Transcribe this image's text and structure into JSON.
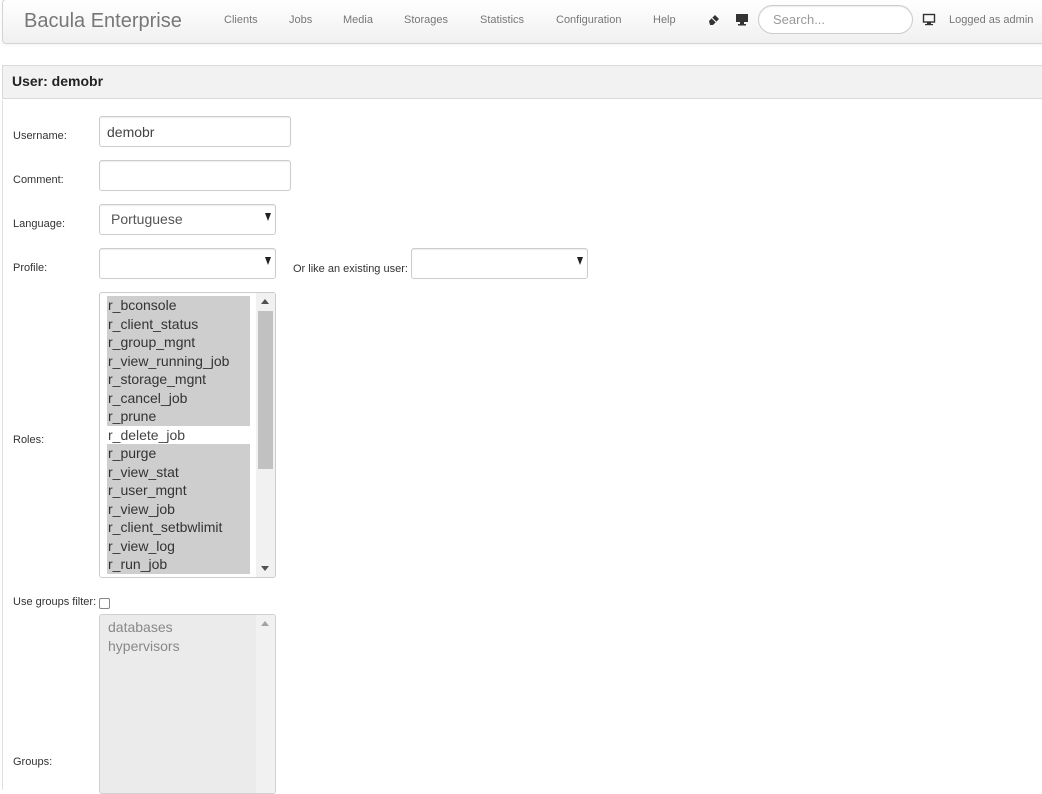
{
  "navbar": {
    "brand": "Bacula Enterprise",
    "menu": [
      "Clients",
      "Jobs",
      "Media",
      "Storages",
      "Statistics",
      "Configuration",
      "Help"
    ],
    "icons": [
      "eraser-icon",
      "monitor-icon"
    ],
    "search_placeholder": "Search...",
    "user_icon": "computer-icon",
    "logged_as": "Logged as admin"
  },
  "panel": {
    "title": "User: demobr"
  },
  "form": {
    "username": {
      "label": "Username:",
      "value": "demobr"
    },
    "comment": {
      "label": "Comment:",
      "value": ""
    },
    "language": {
      "label": "Language:",
      "value": "Portuguese"
    },
    "profile": {
      "label": "Profile:",
      "value": ""
    },
    "like_user": {
      "label": "Or like an existing user:",
      "value": ""
    },
    "roles": {
      "label": "Roles:",
      "options": [
        {
          "label": "r_bconsole",
          "selected": true
        },
        {
          "label": "r_client_status",
          "selected": true
        },
        {
          "label": "r_group_mgnt",
          "selected": true
        },
        {
          "label": "r_view_running_job",
          "selected": true
        },
        {
          "label": "r_storage_mgnt",
          "selected": true
        },
        {
          "label": "r_cancel_job",
          "selected": true
        },
        {
          "label": "r_prune",
          "selected": true
        },
        {
          "label": "r_delete_job",
          "selected": false
        },
        {
          "label": "r_purge",
          "selected": true
        },
        {
          "label": "r_view_stat",
          "selected": true
        },
        {
          "label": "r_user_mgnt",
          "selected": true
        },
        {
          "label": "r_view_job",
          "selected": true
        },
        {
          "label": "r_client_setbwlimit",
          "selected": true
        },
        {
          "label": "r_view_log",
          "selected": true
        },
        {
          "label": "r_run_job",
          "selected": true
        }
      ]
    },
    "use_groups_filter": {
      "label": "Use groups filter:",
      "checked": false
    },
    "groups": {
      "label": "Groups:",
      "options": [
        "databases",
        "hypervisors"
      ]
    }
  }
}
